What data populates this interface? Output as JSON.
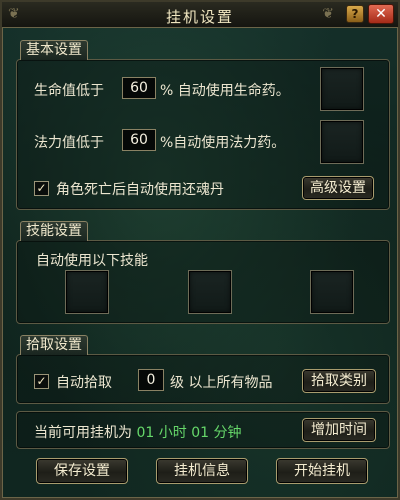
{
  "window": {
    "title": "挂机设置",
    "help_label": "?",
    "close_label": "✕"
  },
  "basic": {
    "tab_label": "基本设置",
    "hp_prefix": "生命值低于",
    "hp_value": "60",
    "hp_suffix": "% 自动使用生命药。",
    "mp_prefix": "法力值低于",
    "mp_value": "60",
    "mp_suffix": "%自动使用法力药。",
    "revive_label": "角色死亡后自动使用还魂丹",
    "revive_checked": "✓",
    "advanced_button": "高级设置"
  },
  "skills": {
    "tab_label": "技能设置",
    "auto_label": "自动使用以下技能"
  },
  "pickup": {
    "tab_label": "拾取设置",
    "auto_label": "自动拾取",
    "auto_checked": "✓",
    "level_value": "0",
    "level_suffix": "级 以上所有物品",
    "category_button": "拾取类别"
  },
  "time": {
    "prefix": "当前可用挂机为",
    "hours": "01",
    "hours_unit": "小时",
    "minutes": "01",
    "minutes_unit": "分钟",
    "add_button": "增加时间"
  },
  "footer": {
    "save_button": "保存设置",
    "info_button": "挂机信息",
    "start_button": "开始挂机"
  }
}
